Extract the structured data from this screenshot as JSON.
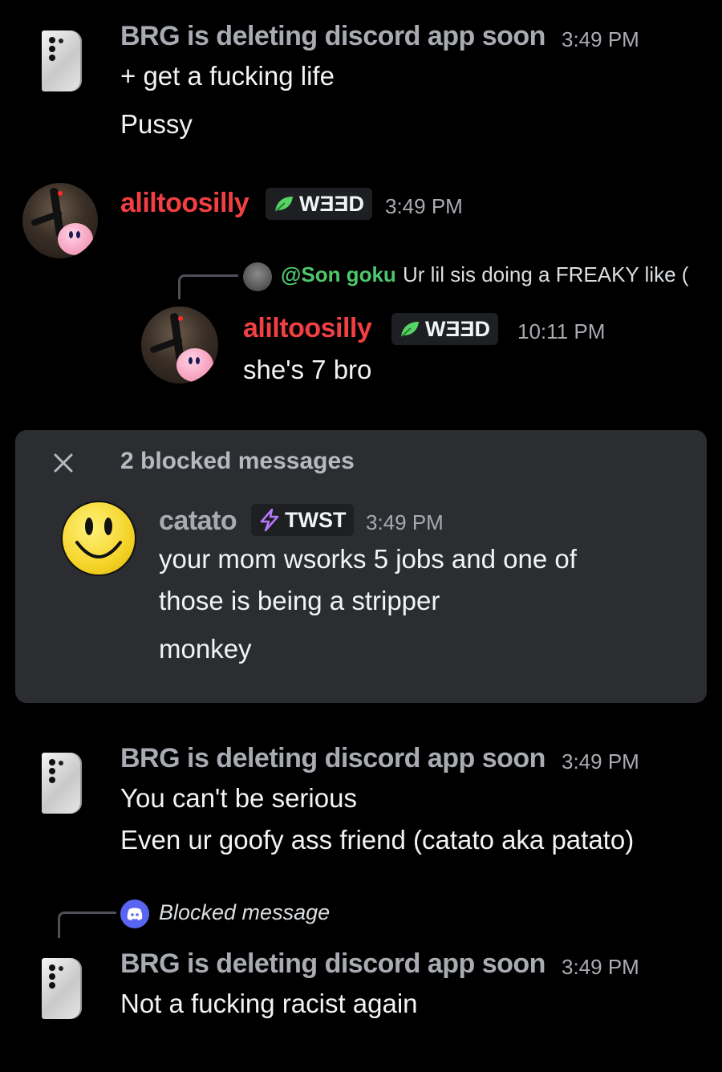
{
  "messages": {
    "group1": {
      "author": "BRG is deleting discord app soon",
      "time": "3:49 PM",
      "lines": [
        "+ get a fucking life",
        "Pussy"
      ]
    },
    "group2": {
      "author": "aliltoosilly",
      "badge": "WƎƎD",
      "time": "3:49 PM",
      "reply": {
        "mention": "@Son goku",
        "preview": "Ur lil sis doing a FREAKY like (",
        "author": "aliltoosilly",
        "badge": "WƎƎD",
        "time": "10:11 PM",
        "text": "she's 7 bro"
      }
    },
    "blocked": {
      "title": "2 blocked messages",
      "author": "catato",
      "badge": "TWST",
      "time": "3:49 PM",
      "lines": [
        "your mom wsorks 5 jobs and one of",
        "those is being a stripper",
        "monkey"
      ]
    },
    "group3": {
      "author": "BRG is deleting discord app soon",
      "time": "3:49 PM",
      "lines": [
        "You can't be serious",
        "Even ur goofy ass friend (catato aka patato)"
      ]
    },
    "group4": {
      "reply_label": "Blocked message",
      "author": "BRG is deleting discord app soon",
      "time": "3:49 PM",
      "text": "Not a fucking racist again"
    }
  },
  "colors": {
    "background": "#000000",
    "panel": "#2b2d31",
    "author_red": "#f23f43",
    "mention_green": "#4ec86c",
    "leaf_green": "#57d463",
    "bolt_purple": "#b678ff",
    "blurple": "#5865f2"
  },
  "icons": [
    "phone-avatar",
    "kirby-avatar",
    "leaf-icon",
    "bolt-icon",
    "close-icon",
    "smiley-avatar",
    "discord-icon"
  ]
}
